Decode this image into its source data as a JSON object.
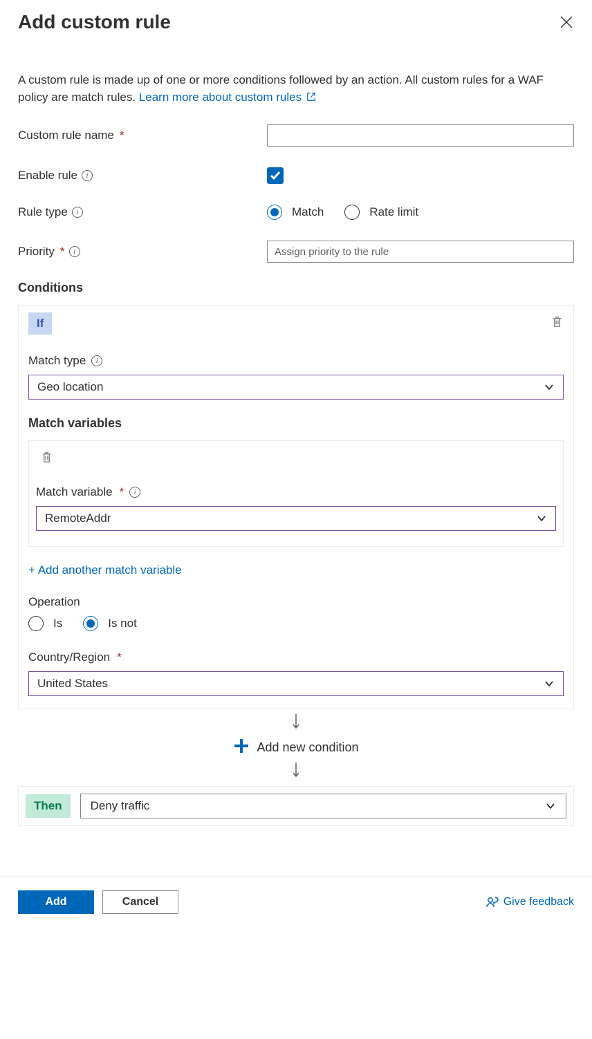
{
  "header": {
    "title": "Add custom rule"
  },
  "description": {
    "text": "A custom rule is made up of one or more conditions followed by an action. All custom rules for a WAF policy are match rules. ",
    "link_text": "Learn more about custom rules"
  },
  "fields": {
    "name_label": "Custom rule name",
    "name_value": "",
    "enable_label": "Enable rule",
    "ruletype_label": "Rule type",
    "ruletype_match": "Match",
    "ruletype_ratelimit": "Rate limit",
    "priority_label": "Priority",
    "priority_placeholder": "Assign priority to the rule"
  },
  "conditions": {
    "title": "Conditions",
    "if_label": "If",
    "match_type_label": "Match type",
    "match_type_value": "Geo location",
    "match_variables_title": "Match variables",
    "match_variable_label": "Match variable",
    "match_variable_value": "RemoteAddr",
    "add_variable_link": "+ Add another match variable",
    "operation_label": "Operation",
    "op_is": "Is",
    "op_isnot": "Is not",
    "country_label": "Country/Region",
    "country_value": "United States",
    "add_condition_label": "Add new condition"
  },
  "then": {
    "label": "Then",
    "action_value": "Deny traffic"
  },
  "footer": {
    "add": "Add",
    "cancel": "Cancel",
    "feedback": "Give feedback"
  }
}
